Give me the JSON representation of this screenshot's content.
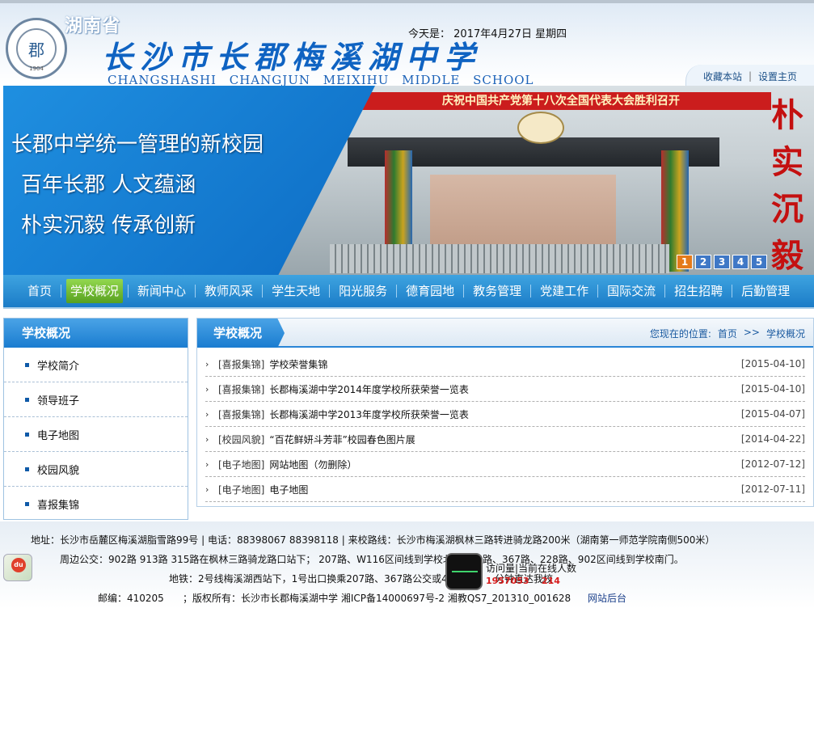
{
  "header": {
    "province": "湖南省",
    "school_name": "长沙市长郡梅溪湖中学",
    "school_name_en": "CHANGSHASHI CHANGJUN MEIXIHU MIDDLE SCHOOL",
    "date_label": "今天是：",
    "date_value": "2017年4月27日 星期四",
    "logo_text": "郡",
    "logo_year": "1904",
    "link_favorite": "收藏本站",
    "link_home": "设置主页",
    "link_sep": "|"
  },
  "banner": {
    "slogan1": "长郡中学统一管理的新校园",
    "slogan2": "百年长郡 人文蕴涵",
    "slogan3": "朴实沉毅 传承创新",
    "gate_banner": "庆祝中国共产党第十八次全国代表大会胜利召开",
    "vertical_text": "朴实沉毅",
    "pager": [
      "1",
      "2",
      "3",
      "4",
      "5"
    ],
    "active_page": 0
  },
  "nav": {
    "items": [
      "首页",
      "学校概况",
      "新闻中心",
      "教师风采",
      "学生天地",
      "阳光服务",
      "德育园地",
      "教务管理",
      "党建工作",
      "国际交流",
      "招生招聘",
      "后勤管理"
    ],
    "active": 1
  },
  "sidebar": {
    "title": "学校概况",
    "items": [
      "学校简介",
      "领导班子",
      "电子地图",
      "校园风貌",
      "喜报集锦"
    ]
  },
  "main": {
    "title": "学校概况",
    "crumb_label": "您现在的位置:",
    "crumb_home": "首页",
    "crumb_sep": ">>",
    "crumb_current": "学校概况",
    "rows": [
      {
        "cat": "[喜报集锦]",
        "title": "学校荣誉集锦",
        "date": "[2015-04-10]"
      },
      {
        "cat": "[喜报集锦]",
        "title": "长郡梅溪湖中学2014年度学校所获荣誉一览表",
        "date": "[2015-04-10]"
      },
      {
        "cat": "[喜报集锦]",
        "title": "长郡梅溪湖中学2013年度学校所获荣誉一览表",
        "date": "[2015-04-07]"
      },
      {
        "cat": "[校园风貌]",
        "title": "“百花鲜妍斗芳菲”校园春色图片展",
        "date": "[2014-04-22]"
      },
      {
        "cat": "[电子地图]",
        "title": "网站地图（勿删除）",
        "date": "[2012-07-12]"
      },
      {
        "cat": "[电子地图]",
        "title": "电子地图",
        "date": "[2012-07-11]"
      }
    ]
  },
  "footer": {
    "address": "地址：长沙市岳麓区梅溪湖脂雪路99号 | 电话：88398067 88398118 | 来校路线：长沙市梅溪湖枫林三路转进骑龙路200米（湖南第一师范学院南侧500米）",
    "bus": "周边公交：902路 913路 315路在枫林三路骑龙路口站下； 207路、W116区间线到学校北门",
    "bus2": "路、367路、228路、902区间线到学校南门。",
    "subway": "地铁：2号线梅溪湖西站下，1号出口换乘207路、367路公交或4号",
    "subway2": "分钟直达我校",
    "postcode": "邮编：410205",
    "copyright": "；版权所有：长沙市长郡梅溪湖中学 湘ICP备14000697号-2 湘教QS7_201310_001628",
    "admin": "网站后台",
    "stat_label": "访问量|当前在线人数",
    "stat_total": "1957053",
    "stat_online": "214",
    "map_badge": "du"
  }
}
